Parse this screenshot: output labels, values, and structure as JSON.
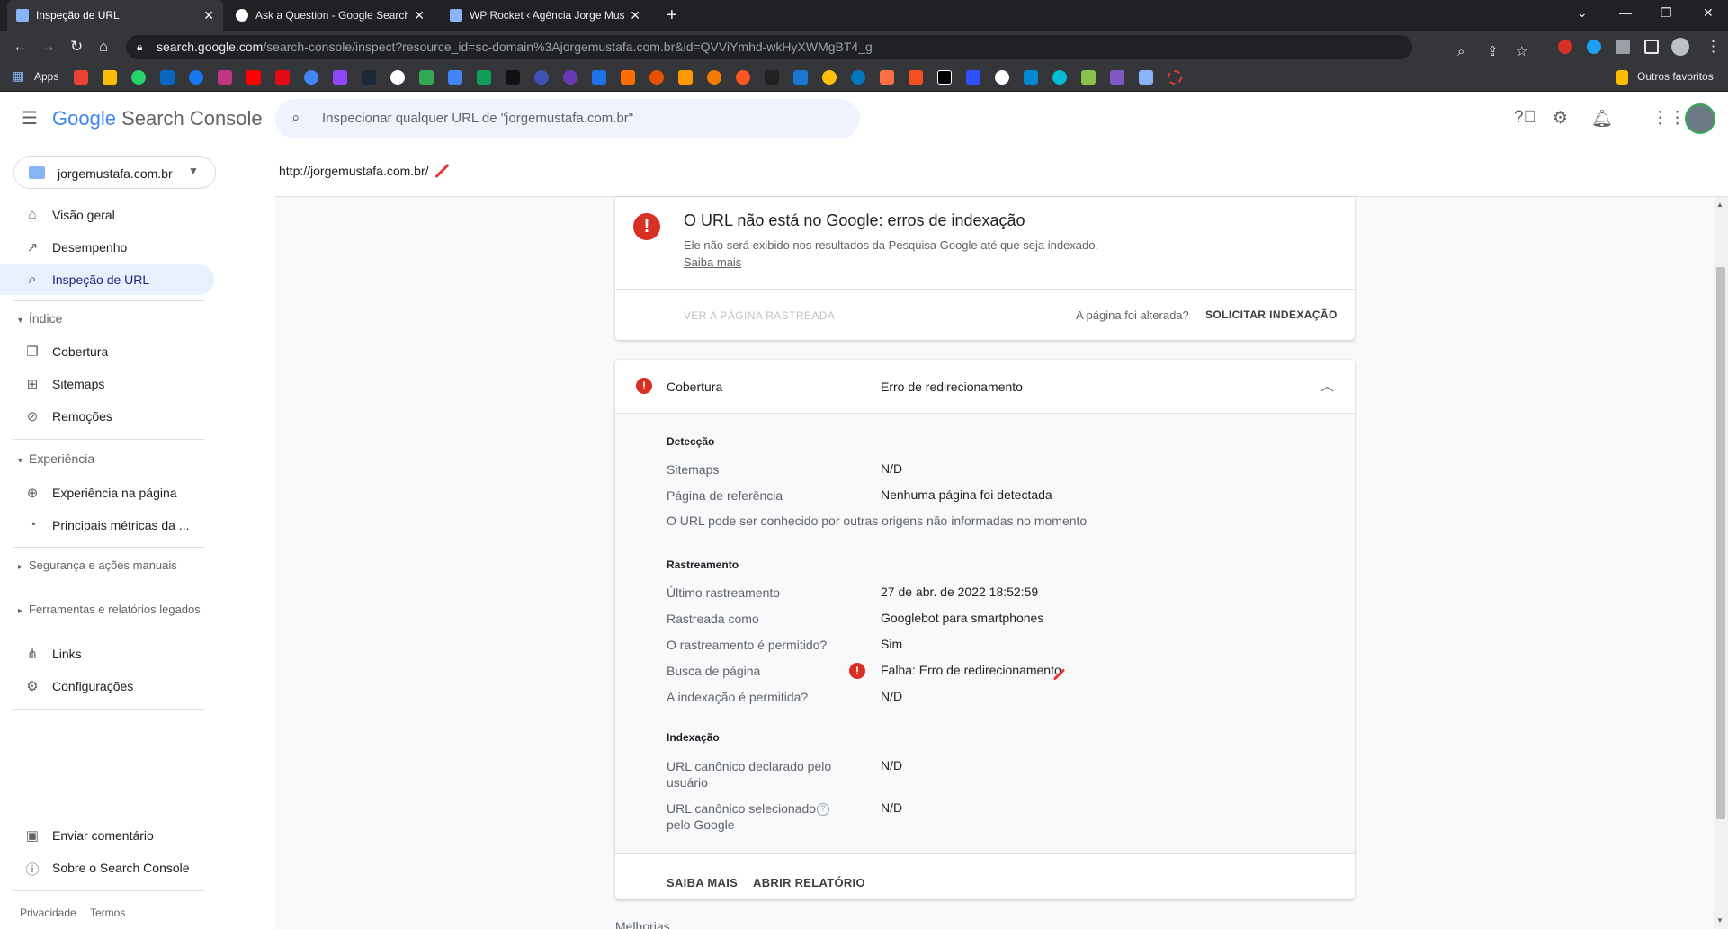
{
  "browser": {
    "tabs": [
      {
        "title": "Inspeção de URL"
      },
      {
        "title": "Ask a Question - Google Search C"
      },
      {
        "title": "WP Rocket ‹ Agência Jorge Must"
      }
    ],
    "url_host": "search.google.com",
    "url_path": "/search-console/inspect?resource_id=sc-domain%3Ajorgemustafa.com.br&id=QVViYmhd-wkHyXWMgBT4_g",
    "bookmarks_apps": "Apps",
    "bookmarks_other": "Outros favoritos"
  },
  "header": {
    "logo_google": "Google",
    "logo_product": "Search Console",
    "search_placeholder": "Inspecionar qualquer URL de \"jorgemustafa.com.br\""
  },
  "property": {
    "name": "jorgemustafa.com.br"
  },
  "sidebar": {
    "items": [
      {
        "label": "Visão geral",
        "icon": "home-icon"
      },
      {
        "label": "Desempenho",
        "icon": "trending-icon"
      },
      {
        "label": "Inspeção de URL",
        "icon": "search-icon",
        "selected": true
      }
    ],
    "sections": {
      "indice": "Índice",
      "indice_items": [
        "Cobertura",
        "Sitemaps",
        "Remoções"
      ],
      "experiencia": "Experiência",
      "experiencia_items": [
        "Experiência na página",
        "Principais métricas da ..."
      ],
      "seguranca": "Segurança e ações manuais",
      "ferramentas": "Ferramentas e relatórios legados",
      "other_items": [
        "Links",
        "Configurações"
      ],
      "bottom_items": [
        "Enviar comentário",
        "Sobre o Search Console"
      ]
    },
    "footer": {
      "privacy": "Privacidade",
      "terms": "Termos"
    }
  },
  "inspected_url": "http://jorgemustafa.com.br/",
  "status_card": {
    "title": "O URL não está no Google: erros de indexação",
    "subtitle": "Ele não será exibido nos resultados da Pesquisa Google até que seja indexado.",
    "link": "Saiba mais",
    "view_crawled": "VER A PÁGINA RASTREADA",
    "page_changed": "A página foi alterada?",
    "request_indexing": "SOLICITAR INDEXAÇÃO"
  },
  "coverage_card": {
    "label": "Cobertura",
    "value": "Erro de redirecionamento",
    "groups": {
      "deteccao": "Detecção",
      "rastreamento": "Rastreamento",
      "indexacao": "Indexação"
    },
    "deteccao_rows": [
      {
        "label": "Sitemaps",
        "value": "N/D"
      },
      {
        "label": "Página de referência",
        "value": "Nenhuma página foi detectada"
      }
    ],
    "deteccao_note": "O URL pode ser conhecido por outras origens não informadas no momento",
    "rastreamento_rows": [
      {
        "label": "Último rastreamento",
        "value": "27 de abr. de 2022 18:52:59"
      },
      {
        "label": "Rastreada como",
        "value": "Googlebot para smartphones"
      },
      {
        "label": "O rastreamento é permitido?",
        "value": "Sim"
      },
      {
        "label": "Busca de página",
        "value": "Falha: Erro de redirecionamento"
      },
      {
        "label": "A indexação é permitida?",
        "value": "N/D"
      }
    ],
    "indexacao_rows": [
      {
        "label": "URL canônico declarado pelo usuário",
        "value": "N/D"
      },
      {
        "label": "URL canônico selecionado pelo Google",
        "value": "N/D"
      }
    ],
    "btn_learn": "SAIBA MAIS",
    "btn_report": "ABRIR RELATÓRIO"
  },
  "melhorias": "Melhorias",
  "colors": {
    "accent": "#1a73e8",
    "error": "#d93025",
    "selected_bg": "#e8f0fe"
  }
}
